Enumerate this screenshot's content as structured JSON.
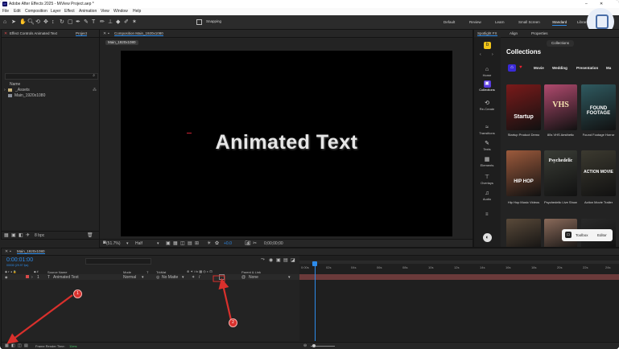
{
  "window": {
    "title": "Adobe After Effects 2025 - MiView Project.aep *"
  },
  "menu": [
    "File",
    "Edit",
    "Composition",
    "Layer",
    "Effect",
    "Animation",
    "View",
    "Window",
    "Help"
  ],
  "toolbar": {
    "snapping_label": "Snapping",
    "workspaces": [
      "Default",
      "Review",
      "Learn",
      "Small Screen",
      "Standard",
      "Libraries"
    ],
    "active_workspace": "Standard"
  },
  "effect_controls": {
    "tab_label": "Effect Controls Animated Text",
    "project_tab": "Project"
  },
  "project": {
    "column_name": "Name",
    "items": [
      {
        "name": "_Assets",
        "type": "folder"
      },
      {
        "name": "Main_1920x1080",
        "type": "composition"
      }
    ],
    "bpc": "8 bpc"
  },
  "composition": {
    "tab_label": "Composition Main_1920x1080",
    "sub_tab": "Main_1920x1080",
    "text": "Animated Text",
    "zoom": "(51.7%)",
    "resolution": "Half",
    "exposure": "+0.0",
    "timecode": "0;00;00;00"
  },
  "spotlight": {
    "tabs": [
      "Spotlight FX",
      "Align",
      "Properties"
    ],
    "collections_button": "Collections",
    "heading": "Collections",
    "sidebar": [
      "Home",
      "Collections",
      "Re-Create",
      "Transitions",
      "Texts",
      "Elements",
      "Overlays",
      "Audio"
    ],
    "categories": [
      "Movie",
      "Wedding",
      "Presentation",
      "Ma"
    ],
    "cards": [
      {
        "title": "Startup Product Demo",
        "thumb_text": "Startup",
        "color": "#7a1a1a"
      },
      {
        "title": "80s VHS Aesthetic",
        "thumb_text": "VHS",
        "color": "#b04a6e"
      },
      {
        "title": "Found Footage Horror",
        "thumb_text": "FOUND FOOTAGE",
        "color": "#2f5a60"
      },
      {
        "title": "Hip Hop Music Videos",
        "thumb_text": "HIP HOP",
        "color": "#9c5a3c"
      },
      {
        "title": "Psychedelic Live Show",
        "thumb_text": "Psychedelic",
        "color": "#3a3d36"
      },
      {
        "title": "Action Movie Trailer",
        "thumb_text": "ACTION MOVIE",
        "color": "#3c3a30"
      },
      {
        "title": "",
        "thumb_text": "",
        "color": "#5a4a3a"
      },
      {
        "title": "",
        "thumb_text": "",
        "color": "#8a6a5a"
      },
      {
        "title": "",
        "thumb_text": "",
        "color": "#2a2a2a"
      }
    ],
    "toolbox_label": "Toolbox",
    "editor_label": "Editor"
  },
  "timeline": {
    "tab_label": "Main_1920x1080",
    "timecode": "0:00:01:00",
    "timecode_sub": "00030 (29.97 fps)",
    "columns": {
      "source": "Source Name",
      "mode": "Mode",
      "t": "T",
      "trkmat": "TrkMat",
      "parent": "Parent & Link"
    },
    "layer": {
      "index": "1",
      "name": "Animated Text",
      "mode": "Normal",
      "trkmat": "No Matte",
      "parent": "None"
    },
    "ruler_marks": [
      "0:00s",
      "02s",
      "04s",
      "06s",
      "08s",
      "10s",
      "12s",
      "14s",
      "16s",
      "18s",
      "20s",
      "22s",
      "24s"
    ],
    "render_label": "Frame Render Time:",
    "render_value": "11ms"
  },
  "annotations": [
    {
      "label": "1"
    },
    {
      "label": "2"
    }
  ],
  "colors": {
    "accent": "#2d8ceb",
    "arrow": "#d9302c",
    "panel": "#232323"
  }
}
